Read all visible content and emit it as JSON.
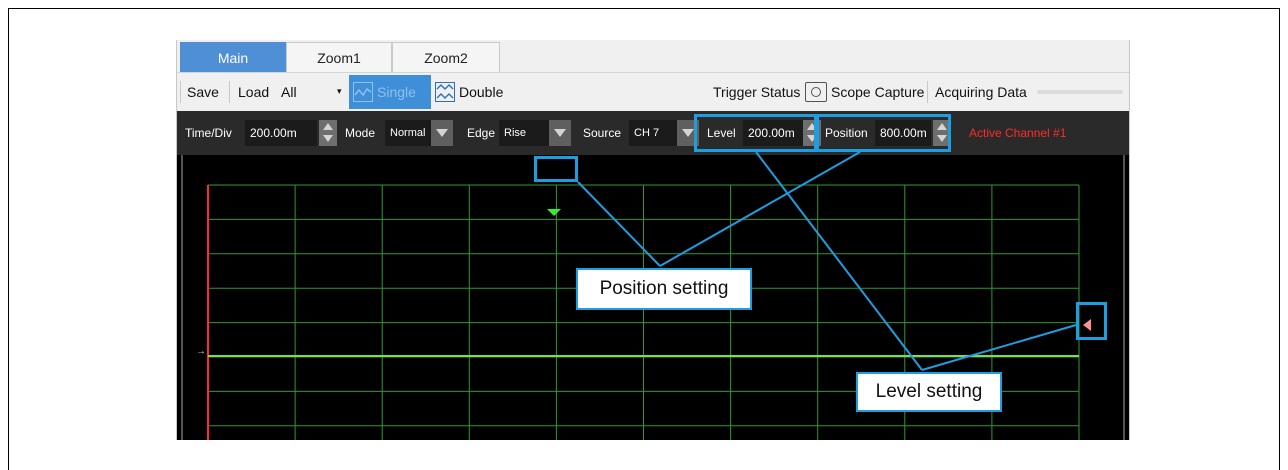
{
  "tabs": [
    "Main",
    "Zoom1",
    "Zoom2"
  ],
  "toolbar": {
    "save": "Save",
    "load": "Load",
    "load_value": "All",
    "single": "Single",
    "double": "Double",
    "trigger_status": "Trigger Status",
    "scope_capture": "Scope Capture",
    "acquiring": "Acquiring Data"
  },
  "controls": {
    "time_div_label": "Time/Div",
    "time_div_value": "200.00m",
    "mode_label": "Mode",
    "mode_value": "Normal",
    "edge_label": "Edge",
    "edge_value": "Rise",
    "source_label": "Source",
    "source_value": "CH 7",
    "level_label": "Level",
    "level_value": "200.00m",
    "position_label": "Position",
    "position_value": "800.00m",
    "active_channel": "Active Channel #1"
  },
  "callouts": {
    "position": "Position setting",
    "level": "Level setting"
  },
  "colors": {
    "accent": "#1e9de0",
    "tab_active": "#4f8fd6",
    "grid": "#2e9a2e",
    "trace": "#7cdc5a",
    "trigger_marker": "#ff9090",
    "active_channel": "#ff2a2a"
  }
}
